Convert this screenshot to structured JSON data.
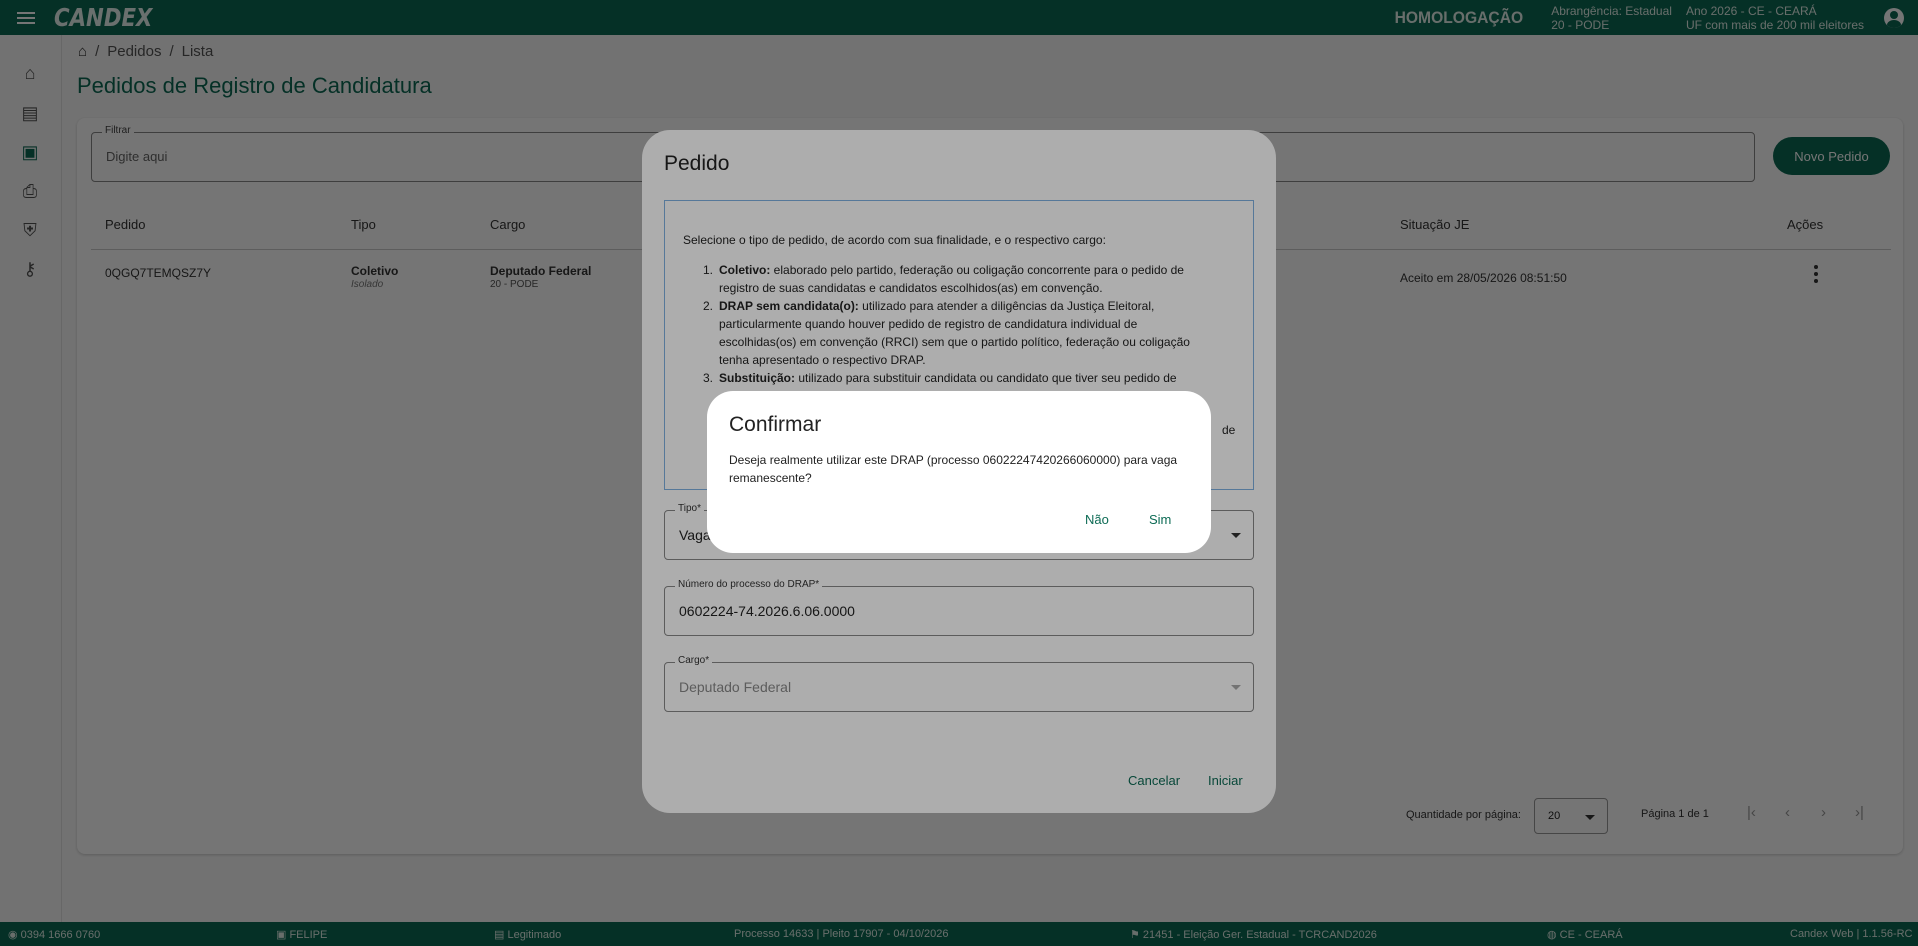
{
  "topbar": {
    "logo": "CANDEX",
    "environment": "HOMOLOGAÇÃO",
    "scope_line1": "Abrangência: Estadual",
    "scope_line2": "20 - PODE",
    "year_line1": "Ano 2026 - CE - CEARÁ",
    "year_line2": "UF com mais de 200 mil eleitores"
  },
  "sidebar": {
    "items": [
      {
        "icon": "home-icon",
        "glyph": "⌂"
      },
      {
        "icon": "document-icon",
        "glyph": "▤"
      },
      {
        "icon": "badge-icon",
        "glyph": "▣"
      },
      {
        "icon": "print-icon",
        "glyph": "⎙"
      },
      {
        "icon": "shield-icon",
        "glyph": "⛨"
      },
      {
        "icon": "key-icon",
        "glyph": "⚷"
      }
    ]
  },
  "breadcrumb": {
    "sep": "/",
    "item1": "Pedidos",
    "item2": "Lista"
  },
  "page_title": "Pedidos de Registro de Candidatura",
  "filter": {
    "label": "Filtrar",
    "placeholder": "Digite aqui"
  },
  "new_button": "Novo Pedido",
  "table": {
    "headers": {
      "pedido": "Pedido",
      "tipo": "Tipo",
      "cargo": "Cargo",
      "situacao": "Situação JE",
      "acoes": "Ações"
    },
    "rows": [
      {
        "pedido": "0QGQ7TEMQSZ7Y",
        "tipo": "Coletivo",
        "tipo_sub": "Isolado",
        "cargo": "Deputado Federal",
        "cargo_sub": "20 - PODE",
        "situacao": "Aceito em 28/05/2026 08:51:50"
      }
    ]
  },
  "pagination": {
    "label": "Quantidade por página:",
    "per_page": "20",
    "page_text": "Página 1 de 1",
    "first": "|‹",
    "prev": "‹",
    "next": "›",
    "last": "›|"
  },
  "footer": {
    "phone": "0394 1666 0760",
    "user": "FELIPE",
    "role": "Legitimado",
    "process": "Processo 14633 | Pleito 17907 - 04/10/2026",
    "election": "21451 - Eleição Ger. Estadual - TCRCAND2026",
    "state": "CE - CEARÁ",
    "version": "Candex Web | 1.1.56-RC"
  },
  "dialog": {
    "title": "Pedido",
    "intro": "Selecione o tipo de pedido, de acordo com sua finalidade, e o respectivo cargo:",
    "items": [
      {
        "num": "1.",
        "bold": "Coletivo:",
        "line1": " elaborado pelo partido, federação ou coligação concorrente para o pedido de",
        "line2": "registro de suas candidatas e candidatos escolhidos(as) em convenção."
      },
      {
        "num": "2.",
        "bold": "DRAP sem candidata(o):",
        "line1": " utilizado para atender a diligências da Justiça Eleitoral,",
        "line2": "particularmente quando houver pedido de registro de candidatura individual de",
        "line3": "escolhidas(os) em convenção (RRCI) sem que o partido político, federação ou coligação",
        "line4": "tenha apresentado o respectivo DRAP."
      },
      {
        "num": "3.",
        "bold": "Substituição:",
        "line1": " utilizado para substituir candidata ou candidato que tiver seu pedido de"
      }
    ],
    "hidden_tail": "de",
    "tipo_label": "Tipo*",
    "tipo_value": "Vaga",
    "drap_label": "Número do processo do DRAP*",
    "drap_value": "0602224-74.2026.6.06.0000",
    "cargo_label": "Cargo*",
    "cargo_value": "Deputado Federal",
    "cancel": "Cancelar",
    "start": "Iniciar"
  },
  "confirm": {
    "title": "Confirmar",
    "message": "Deseja realmente utilizar este DRAP (processo 06022247420266060000) para vaga remanescente?",
    "no": "Não",
    "yes": "Sim"
  }
}
